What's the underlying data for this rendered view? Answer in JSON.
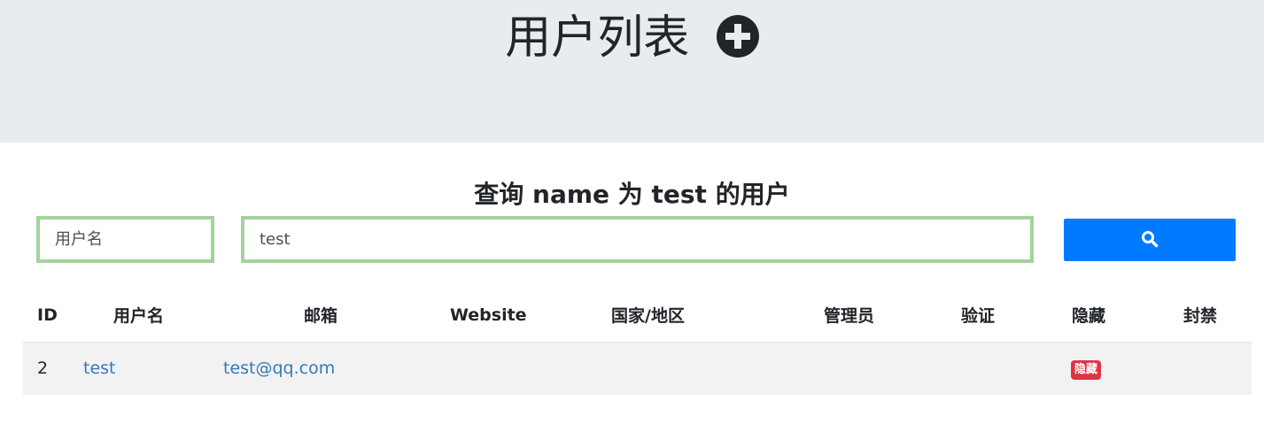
{
  "header": {
    "title": "用户列表",
    "add_icon": "plus-circle-icon",
    "background": "#e9ecef"
  },
  "search": {
    "heading": "查询 name 为 test 的用户",
    "field_value": "用户名",
    "query_value": "test",
    "button_icon": "search-icon",
    "button_color": "#007bff",
    "border_color": "#a3d39c"
  },
  "table": {
    "headers": [
      "ID",
      "用户名",
      "邮箱",
      "Website",
      "国家/地区",
      "管理员",
      "验证",
      "隐藏",
      "封禁"
    ],
    "rows": [
      {
        "id": "2",
        "username": "test",
        "email": "test@qq.com",
        "website": "",
        "country": "",
        "admin": "",
        "verified": "",
        "hidden": "隐藏",
        "banned": ""
      }
    ],
    "link_color": "#337ab7",
    "badge_color": "#dc3545"
  }
}
